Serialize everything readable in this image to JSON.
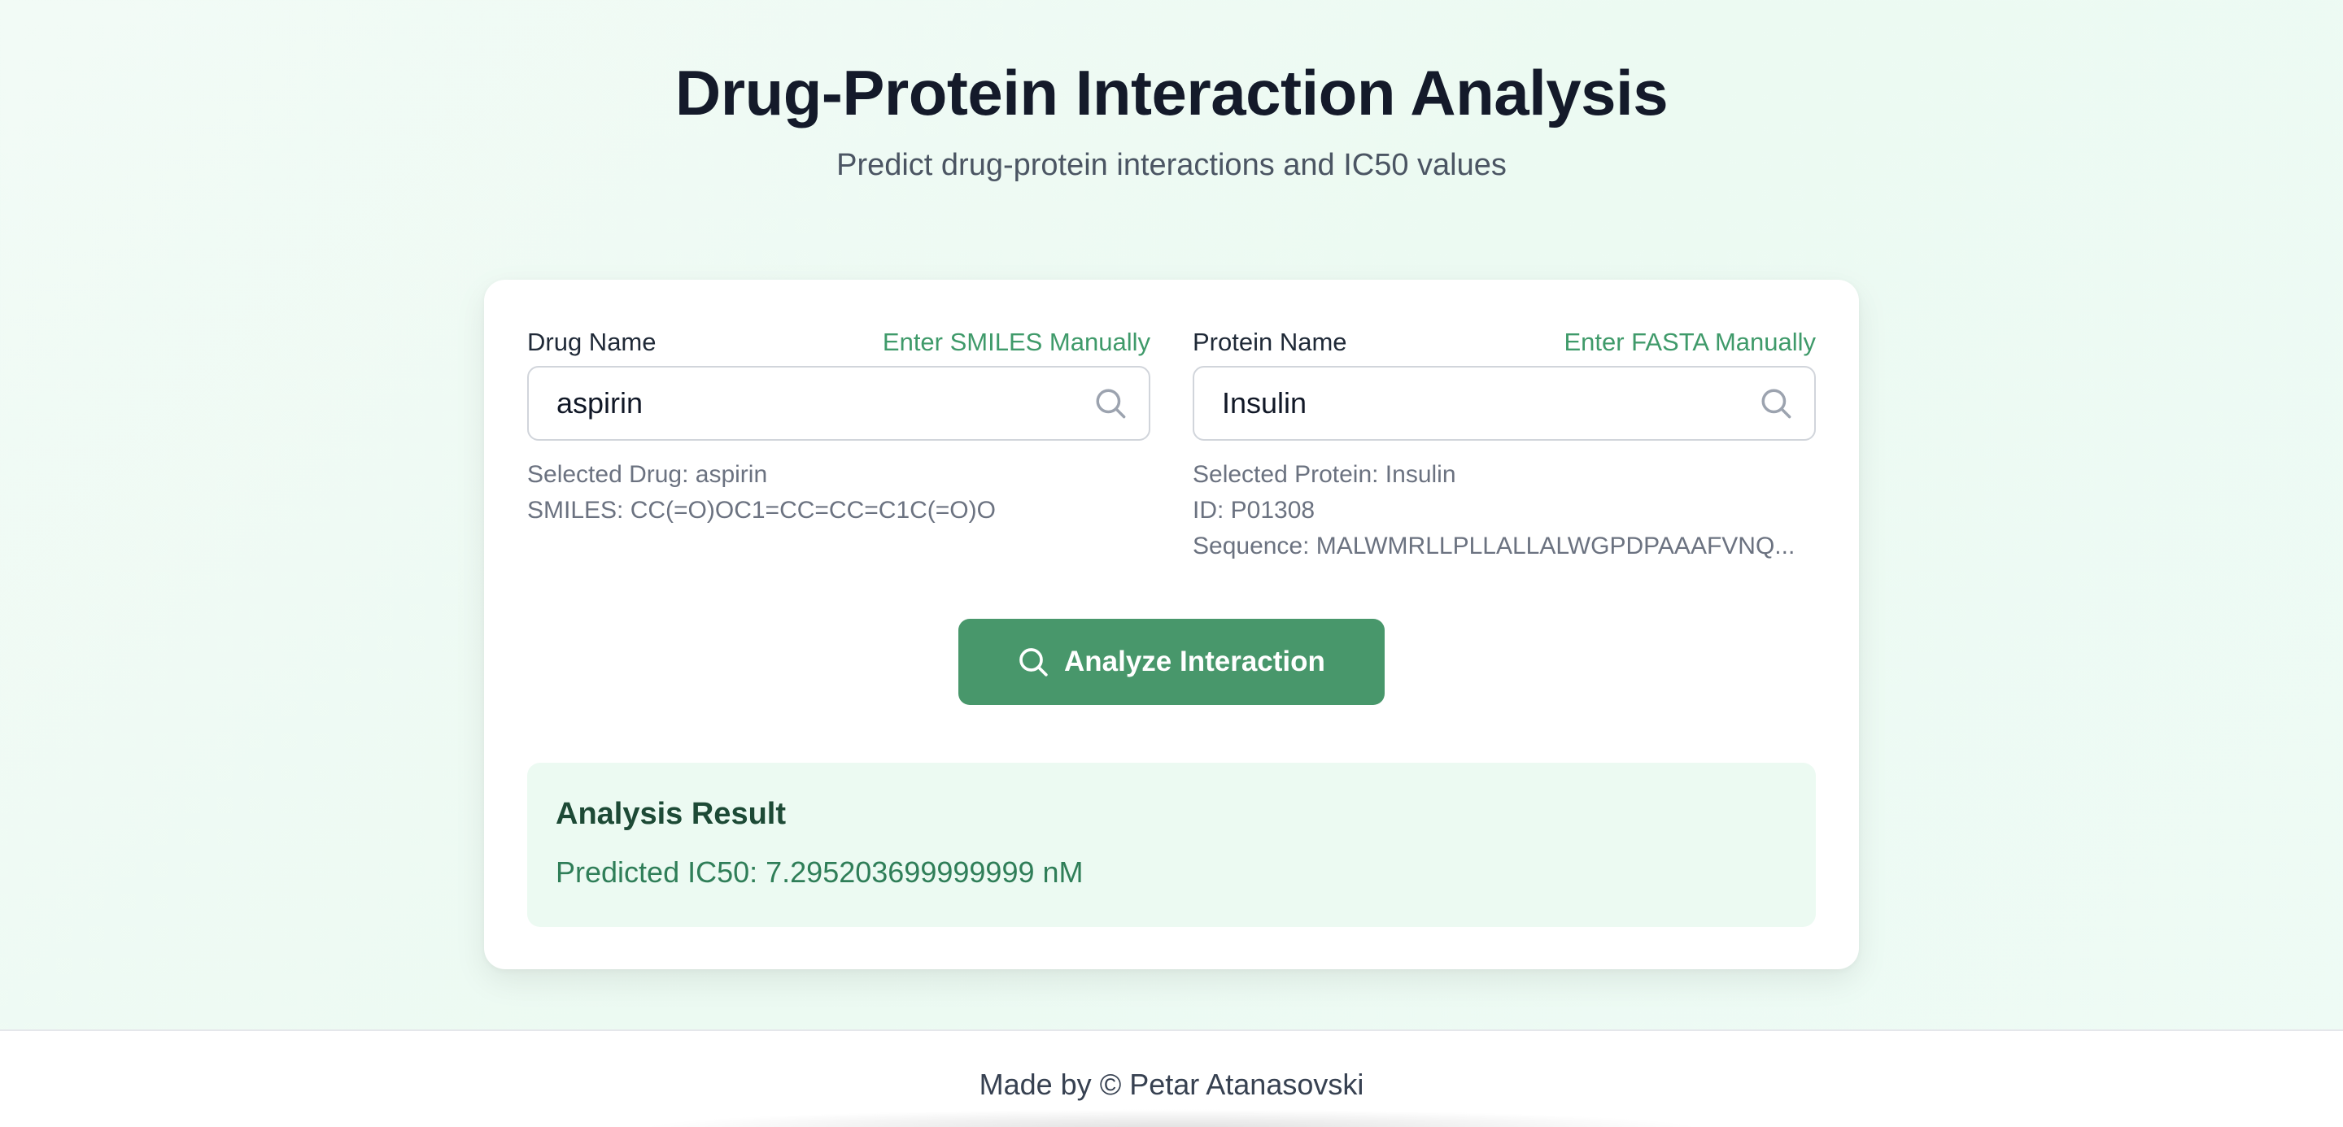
{
  "header": {
    "title": "Drug-Protein Interaction Analysis",
    "subtitle": "Predict drug-protein interactions and IC50 values"
  },
  "drug": {
    "label": "Drug Name",
    "manual_link": "Enter SMILES Manually",
    "input_value": "aspirin",
    "selected_line": "Selected Drug: aspirin",
    "smiles_line": "SMILES: CC(=O)OC1=CC=CC=C1C(=O)O",
    "icon": "search-icon"
  },
  "protein": {
    "label": "Protein Name",
    "manual_link": "Enter FASTA Manually",
    "input_value": "Insulin",
    "selected_line": "Selected Protein: Insulin",
    "id_line": "ID: P01308",
    "sequence_line": "Sequence: MALWMRLLPLLALLALWGPDPAAAFVNQ...",
    "icon": "search-icon"
  },
  "action": {
    "analyze_label": "Analyze Interaction",
    "icon": "search-icon"
  },
  "result": {
    "title": "Analysis Result",
    "value": "Predicted IC50: 7.295203699999999 nM"
  },
  "footer": {
    "text": "Made by © Petar Atanasovski"
  },
  "colors": {
    "accent": "#48976b",
    "link": "#3f9a6a",
    "result_bg": "#ecfaf2",
    "result_title": "#1d4a36",
    "result_value": "#2f7e58"
  }
}
